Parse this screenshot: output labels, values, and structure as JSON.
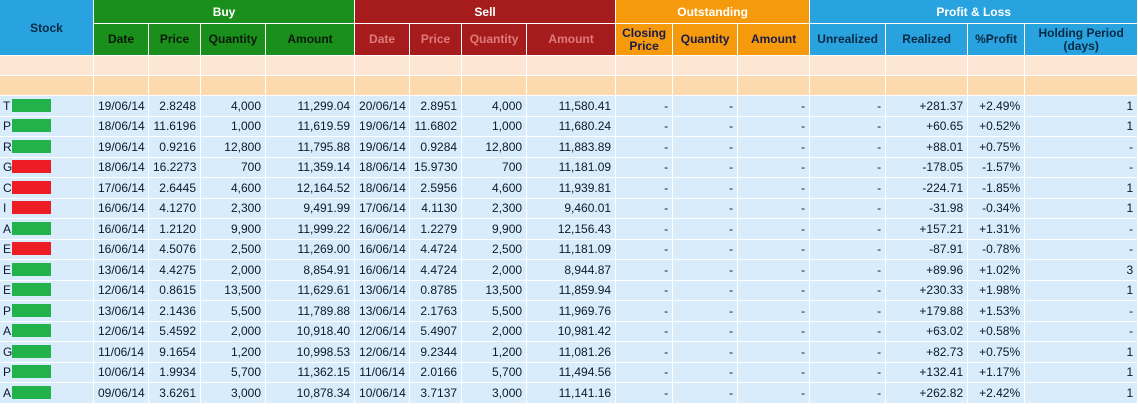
{
  "header": {
    "stock": "Stock",
    "groups": {
      "buy": "Buy",
      "sell": "Sell",
      "outstanding": "Outstanding",
      "pl": "Profit & Loss"
    },
    "columns": {
      "buy": [
        "Date",
        "Price",
        "Quantity",
        "Amount"
      ],
      "sell": [
        "Date",
        "Price",
        "Quantity",
        "Amount"
      ],
      "outstanding": [
        "Closing Price",
        "Quantity",
        "Amount"
      ],
      "pl": [
        "Unrealized",
        "Realized",
        "%Profit",
        "Holding Period (days)"
      ]
    }
  },
  "colors": {
    "gain_bar": "#22b24c",
    "loss_bar": "#ee1c25"
  },
  "rows": [
    {
      "stock": "T",
      "trend": "up",
      "buy_date": "19/06/14",
      "buy_price": "2.8248",
      "buy_qty": "4,000",
      "buy_amount": "11,299.04",
      "sell_date": "20/06/14",
      "sell_price": "2.8951",
      "sell_qty": "4,000",
      "sell_amount": "11,580.41",
      "close_price": "-",
      "out_qty": "-",
      "out_amount": "-",
      "unrealized": "-",
      "realized": "+281.37",
      "pct": "+2.49%",
      "holding": "1"
    },
    {
      "stock": "P",
      "trend": "up",
      "buy_date": "18/06/14",
      "buy_price": "11.6196",
      "buy_qty": "1,000",
      "buy_amount": "11,619.59",
      "sell_date": "19/06/14",
      "sell_price": "11.6802",
      "sell_qty": "1,000",
      "sell_amount": "11,680.24",
      "close_price": "-",
      "out_qty": "-",
      "out_amount": "-",
      "unrealized": "-",
      "realized": "+60.65",
      "pct": "+0.52%",
      "holding": "1"
    },
    {
      "stock": "R",
      "trend": "up",
      "buy_date": "19/06/14",
      "buy_price": "0.9216",
      "buy_qty": "12,800",
      "buy_amount": "11,795.88",
      "sell_date": "19/06/14",
      "sell_price": "0.9284",
      "sell_qty": "12,800",
      "sell_amount": "11,883.89",
      "close_price": "-",
      "out_qty": "-",
      "out_amount": "-",
      "unrealized": "-",
      "realized": "+88.01",
      "pct": "+0.75%",
      "holding": "-"
    },
    {
      "stock": "G",
      "trend": "down",
      "buy_date": "18/06/14",
      "buy_price": "16.2273",
      "buy_qty": "700",
      "buy_amount": "11,359.14",
      "sell_date": "18/06/14",
      "sell_price": "15.9730",
      "sell_qty": "700",
      "sell_amount": "11,181.09",
      "close_price": "-",
      "out_qty": "-",
      "out_amount": "-",
      "unrealized": "-",
      "realized": "-178.05",
      "pct": "-1.57%",
      "holding": "-"
    },
    {
      "stock": "C",
      "trend": "down",
      "buy_date": "17/06/14",
      "buy_price": "2.6445",
      "buy_qty": "4,600",
      "buy_amount": "12,164.52",
      "sell_date": "18/06/14",
      "sell_price": "2.5956",
      "sell_qty": "4,600",
      "sell_amount": "11,939.81",
      "close_price": "-",
      "out_qty": "-",
      "out_amount": "-",
      "unrealized": "-",
      "realized": "-224.71",
      "pct": "-1.85%",
      "holding": "1"
    },
    {
      "stock": "I",
      "trend": "down",
      "buy_date": "16/06/14",
      "buy_price": "4.1270",
      "buy_qty": "2,300",
      "buy_amount": "9,491.99",
      "sell_date": "17/06/14",
      "sell_price": "4.1130",
      "sell_qty": "2,300",
      "sell_amount": "9,460.01",
      "close_price": "-",
      "out_qty": "-",
      "out_amount": "-",
      "unrealized": "-",
      "realized": "-31.98",
      "pct": "-0.34%",
      "holding": "1"
    },
    {
      "stock": "A",
      "trend": "up",
      "buy_date": "16/06/14",
      "buy_price": "1.2120",
      "buy_qty": "9,900",
      "buy_amount": "11,999.22",
      "sell_date": "16/06/14",
      "sell_price": "1.2279",
      "sell_qty": "9,900",
      "sell_amount": "12,156.43",
      "close_price": "-",
      "out_qty": "-",
      "out_amount": "-",
      "unrealized": "-",
      "realized": "+157.21",
      "pct": "+1.31%",
      "holding": "-"
    },
    {
      "stock": "E",
      "trend": "down",
      "buy_date": "16/06/14",
      "buy_price": "4.5076",
      "buy_qty": "2,500",
      "buy_amount": "11,269.00",
      "sell_date": "16/06/14",
      "sell_price": "4.4724",
      "sell_qty": "2,500",
      "sell_amount": "11,181.09",
      "close_price": "-",
      "out_qty": "-",
      "out_amount": "-",
      "unrealized": "-",
      "realized": "-87.91",
      "pct": "-0.78%",
      "holding": "-"
    },
    {
      "stock": "E",
      "trend": "up",
      "buy_date": "13/06/14",
      "buy_price": "4.4275",
      "buy_qty": "2,000",
      "buy_amount": "8,854.91",
      "sell_date": "16/06/14",
      "sell_price": "4.4724",
      "sell_qty": "2,000",
      "sell_amount": "8,944.87",
      "close_price": "-",
      "out_qty": "-",
      "out_amount": "-",
      "unrealized": "-",
      "realized": "+89.96",
      "pct": "+1.02%",
      "holding": "3"
    },
    {
      "stock": "E",
      "trend": "up",
      "buy_date": "12/06/14",
      "buy_price": "0.8615",
      "buy_qty": "13,500",
      "buy_amount": "11,629.61",
      "sell_date": "13/06/14",
      "sell_price": "0.8785",
      "sell_qty": "13,500",
      "sell_amount": "11,859.94",
      "close_price": "-",
      "out_qty": "-",
      "out_amount": "-",
      "unrealized": "-",
      "realized": "+230.33",
      "pct": "+1.98%",
      "holding": "1"
    },
    {
      "stock": "P",
      "trend": "up",
      "buy_date": "13/06/14",
      "buy_price": "2.1436",
      "buy_qty": "5,500",
      "buy_amount": "11,789.88",
      "sell_date": "13/06/14",
      "sell_price": "2.1763",
      "sell_qty": "5,500",
      "sell_amount": "11,969.76",
      "close_price": "-",
      "out_qty": "-",
      "out_amount": "-",
      "unrealized": "-",
      "realized": "+179.88",
      "pct": "+1.53%",
      "holding": "-"
    },
    {
      "stock": "A",
      "trend": "up",
      "buy_date": "12/06/14",
      "buy_price": "5.4592",
      "buy_qty": "2,000",
      "buy_amount": "10,918.40",
      "sell_date": "12/06/14",
      "sell_price": "5.4907",
      "sell_qty": "2,000",
      "sell_amount": "10,981.42",
      "close_price": "-",
      "out_qty": "-",
      "out_amount": "-",
      "unrealized": "-",
      "realized": "+63.02",
      "pct": "+0.58%",
      "holding": "-"
    },
    {
      "stock": "G",
      "trend": "up",
      "buy_date": "11/06/14",
      "buy_price": "9.1654",
      "buy_qty": "1,200",
      "buy_amount": "10,998.53",
      "sell_date": "12/06/14",
      "sell_price": "9.2344",
      "sell_qty": "1,200",
      "sell_amount": "11,081.26",
      "close_price": "-",
      "out_qty": "-",
      "out_amount": "-",
      "unrealized": "-",
      "realized": "+82.73",
      "pct": "+0.75%",
      "holding": "1"
    },
    {
      "stock": "P",
      "trend": "up",
      "buy_date": "10/06/14",
      "buy_price": "1.9934",
      "buy_qty": "5,700",
      "buy_amount": "11,362.15",
      "sell_date": "11/06/14",
      "sell_price": "2.0166",
      "sell_qty": "5,700",
      "sell_amount": "11,494.56",
      "close_price": "-",
      "out_qty": "-",
      "out_amount": "-",
      "unrealized": "-",
      "realized": "+132.41",
      "pct": "+1.17%",
      "holding": "1"
    },
    {
      "stock": "A",
      "trend": "up",
      "buy_date": "09/06/14",
      "buy_price": "3.6261",
      "buy_qty": "3,000",
      "buy_amount": "10,878.34",
      "sell_date": "10/06/14",
      "sell_price": "3.7137",
      "sell_qty": "3,000",
      "sell_amount": "11,141.16",
      "close_price": "-",
      "out_qty": "-",
      "out_amount": "-",
      "unrealized": "-",
      "realized": "+262.82",
      "pct": "+2.42%",
      "holding": "1"
    }
  ]
}
